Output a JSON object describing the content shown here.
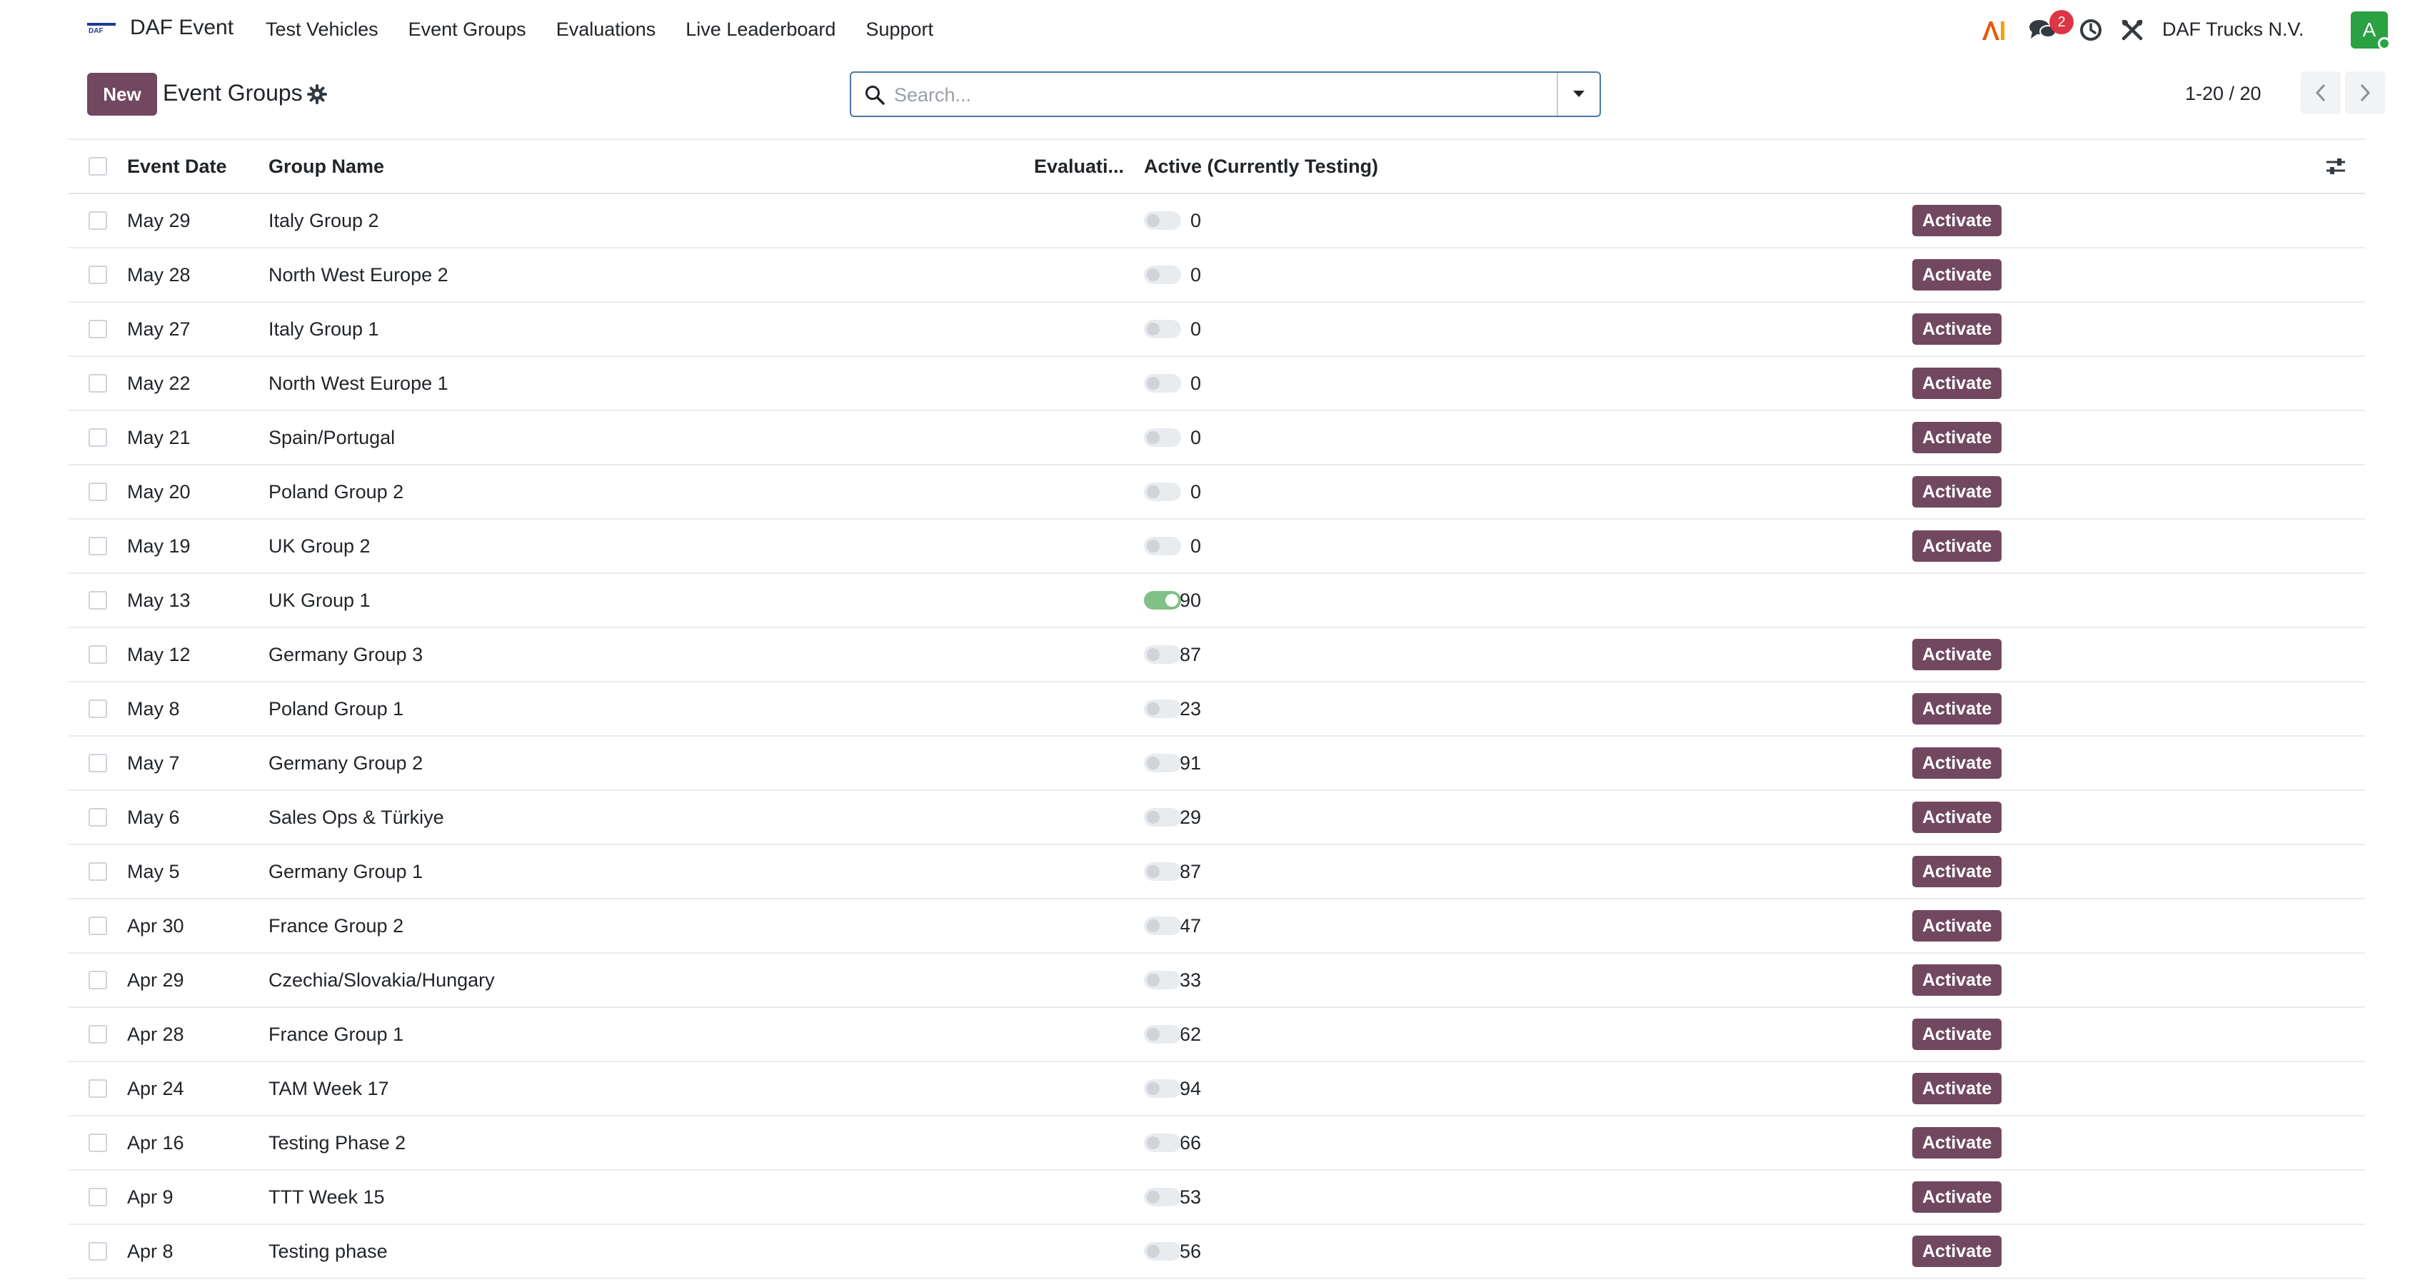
{
  "app": {
    "brand": "DAF Event",
    "nav_items": [
      "Test Vehicles",
      "Event Groups",
      "Evaluations",
      "Live Leaderboard",
      "Support"
    ],
    "chat_badge": "2",
    "company": "DAF Trucks N.V.",
    "avatar_initial": "A",
    "logo_lettering": "DAF"
  },
  "control": {
    "new_label": "New",
    "title": "Event Groups",
    "search_placeholder": "Search...",
    "pager": "1-20 / 20"
  },
  "table": {
    "headers": {
      "date": "Event Date",
      "name": "Group Name",
      "evaluations": "Evaluati...",
      "active": "Active (Currently Testing)"
    },
    "activate_label": "Activate",
    "rows": [
      {
        "date": "May 29",
        "name": "Italy Group 2",
        "evaluations": "0",
        "active": false
      },
      {
        "date": "May 28",
        "name": "North West Europe 2",
        "evaluations": "0",
        "active": false
      },
      {
        "date": "May 27",
        "name": "Italy Group 1",
        "evaluations": "0",
        "active": false
      },
      {
        "date": "May 22",
        "name": "North West Europe 1",
        "evaluations": "0",
        "active": false
      },
      {
        "date": "May 21",
        "name": "Spain/Portugal",
        "evaluations": "0",
        "active": false
      },
      {
        "date": "May 20",
        "name": "Poland Group 2",
        "evaluations": "0",
        "active": false
      },
      {
        "date": "May 19",
        "name": "UK Group 2",
        "evaluations": "0",
        "active": false
      },
      {
        "date": "May 13",
        "name": "UK Group 1",
        "evaluations": "290",
        "active": true
      },
      {
        "date": "May 12",
        "name": "Germany Group 3",
        "evaluations": "587",
        "active": false
      },
      {
        "date": "May 8",
        "name": "Poland Group 1",
        "evaluations": "223",
        "active": false
      },
      {
        "date": "May 7",
        "name": "Germany Group 2",
        "evaluations": "391",
        "active": false
      },
      {
        "date": "May 6",
        "name": "Sales Ops & Türkiye",
        "evaluations": "329",
        "active": false
      },
      {
        "date": "May 5",
        "name": "Germany Group 1",
        "evaluations": "387",
        "active": false
      },
      {
        "date": "Apr 30",
        "name": "France Group 2",
        "evaluations": "247",
        "active": false
      },
      {
        "date": "Apr 29",
        "name": "Czechia/Slovakia/Hungary",
        "evaluations": "433",
        "active": false
      },
      {
        "date": "Apr 28",
        "name": "France Group 1",
        "evaluations": "262",
        "active": false
      },
      {
        "date": "Apr 24",
        "name": "TAM Week 17",
        "evaluations": "394",
        "active": false
      },
      {
        "date": "Apr 16",
        "name": "Testing Phase 2",
        "evaluations": "66",
        "active": false
      },
      {
        "date": "Apr 9",
        "name": "TTT Week 15",
        "evaluations": "253",
        "active": false
      },
      {
        "date": "Apr 8",
        "name": "Testing phase",
        "evaluations": "56",
        "active": false
      }
    ]
  },
  "colors": {
    "primary": "#71485f",
    "toggle_on": "#7fc187",
    "badge": "#dc3545",
    "avatar": "#2aa142",
    "search_border": "#4a78a8"
  }
}
